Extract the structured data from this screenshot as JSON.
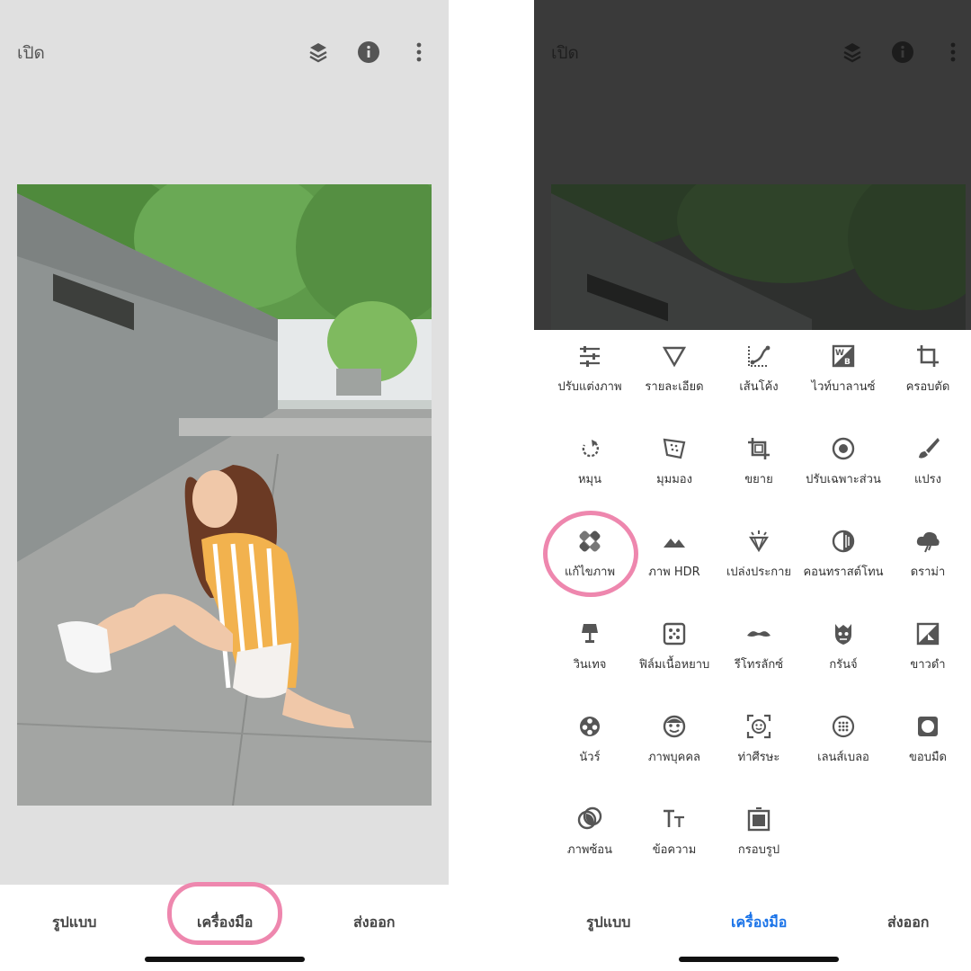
{
  "left_screen": {
    "topbar": {
      "open_label": "เปิด",
      "icons": [
        "stack-icon",
        "info-icon",
        "more-vert-icon"
      ]
    },
    "photo": {
      "subject": "photo-of-woman-sitting-on-pavement"
    },
    "bottom_nav": {
      "styles_label": "รูปแบบ",
      "tools_label": "เครื่องมือ",
      "export_label": "ส่งออก"
    }
  },
  "right_screen": {
    "topbar": {
      "open_label": "เปิด",
      "icons": [
        "stack-icon",
        "info-icon",
        "more-vert-icon"
      ]
    },
    "tools": [
      {
        "label": "ปรับแต่งภาพ",
        "icon": "tune-icon"
      },
      {
        "label": "รายละเอียด",
        "icon": "details-icon"
      },
      {
        "label": "เส้นโค้ง",
        "icon": "curves-icon"
      },
      {
        "label": "ไวท์บาลานซ์",
        "icon": "white-balance-icon"
      },
      {
        "label": "ครอบตัด",
        "icon": "crop-icon"
      },
      {
        "label": "หมุน",
        "icon": "rotate-icon"
      },
      {
        "label": "มุมมอง",
        "icon": "perspective-icon"
      },
      {
        "label": "ขยาย",
        "icon": "expand-icon"
      },
      {
        "label": "ปรับเฉพาะส่วน",
        "icon": "selective-icon"
      },
      {
        "label": "แปรง",
        "icon": "brush-icon"
      },
      {
        "label": "แก้ไขภาพ",
        "icon": "healing-icon"
      },
      {
        "label": "ภาพ HDR",
        "icon": "hdr-icon"
      },
      {
        "label": "เปล่งประกาย",
        "icon": "glamour-glow-icon"
      },
      {
        "label": "คอนทราสต์โทน",
        "icon": "tonal-contrast-icon"
      },
      {
        "label": "ดราม่า",
        "icon": "drama-icon"
      },
      {
        "label": "วินเทจ",
        "icon": "vintage-icon"
      },
      {
        "label": "ฟิล์มเนื้อหยาบ",
        "icon": "grainy-film-icon"
      },
      {
        "label": "รีโทรลักซ์",
        "icon": "retrolux-icon"
      },
      {
        "label": "กรันจ์",
        "icon": "grunge-icon"
      },
      {
        "label": "ขาวดำ",
        "icon": "black-white-icon"
      },
      {
        "label": "นัวร์",
        "icon": "noir-icon"
      },
      {
        "label": "ภาพบุคคล",
        "icon": "portrait-icon"
      },
      {
        "label": "ท่าศีรษะ",
        "icon": "head-pose-icon"
      },
      {
        "label": "เลนส์เบลอ",
        "icon": "lens-blur-icon"
      },
      {
        "label": "ขอบมืด",
        "icon": "vignette-icon"
      },
      {
        "label": "ภาพซ้อน",
        "icon": "double-exposure-icon"
      },
      {
        "label": "ข้อความ",
        "icon": "text-icon"
      },
      {
        "label": "กรอบรูป",
        "icon": "frames-icon"
      }
    ],
    "bottom_nav": {
      "styles_label": "รูปแบบ",
      "tools_label": "เครื่องมือ",
      "export_label": "ส่งออก"
    }
  },
  "colors": {
    "highlight_ring": "#ee87ae",
    "active_tab": "#1a73e8",
    "icon": "#555555"
  }
}
